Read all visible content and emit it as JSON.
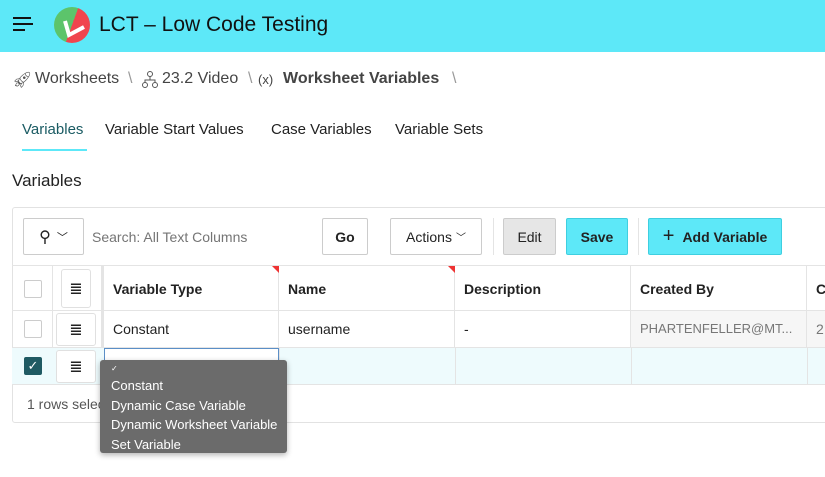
{
  "app": {
    "title": "LCT – Low Code Testing",
    "accent": "#5de8f8"
  },
  "breadcrumb": [
    {
      "label": "Worksheets",
      "icon": "rocket-icon"
    },
    {
      "label": "23.2 Video",
      "icon": "hierarchy-icon"
    },
    {
      "label": "Worksheet Variables",
      "icon": "variable-icon",
      "prefix": "(x)"
    }
  ],
  "breadcrumb_sep": "\\",
  "tabs": [
    "Variables",
    "Variable Start Values",
    "Case Variables",
    "Variable Sets"
  ],
  "section_title": "Variables",
  "toolbar": {
    "search_placeholder": "Search: All Text Columns",
    "go": "Go",
    "actions": "Actions",
    "edit": "Edit",
    "save": "Save",
    "add": "Add Variable"
  },
  "table": {
    "columns": [
      "Variable Type",
      "Name",
      "Description",
      "Created By",
      "C"
    ],
    "rows": [
      {
        "type": "Constant",
        "name": "username",
        "description": "-",
        "created_by": "PHARTENFELLER@MT...",
        "c": "2"
      }
    ],
    "footer": "1 rows selec"
  },
  "dropdown": {
    "check": "✓",
    "options": [
      "Constant",
      "Dynamic Case Variable",
      "Dynamic Worksheet Variable",
      "Set Variable"
    ]
  }
}
